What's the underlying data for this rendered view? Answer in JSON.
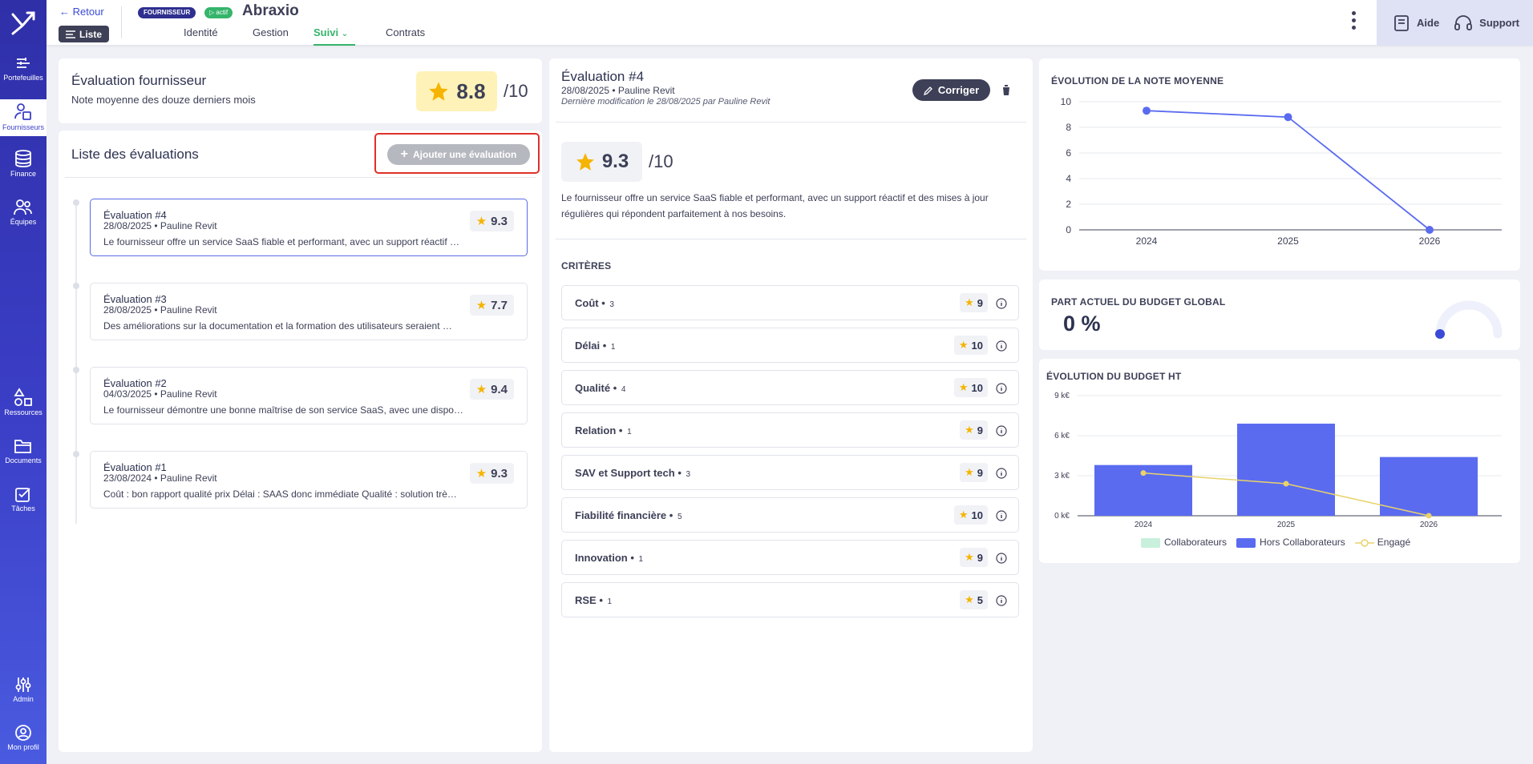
{
  "nav": {
    "items": [
      {
        "label": "Portefeuilles"
      },
      {
        "label": "Fournisseurs"
      },
      {
        "label": "Finance"
      },
      {
        "label": "Équipes"
      },
      {
        "label": "Ressources"
      },
      {
        "label": "Documents"
      },
      {
        "label": "Tâches"
      },
      {
        "label": "Admin"
      },
      {
        "label": "Mon profil"
      }
    ]
  },
  "header": {
    "back": "Retour",
    "liste": "Liste",
    "badge_type": "FOURNISSEUR",
    "badge_status": "actif",
    "vendor": "Abraxio",
    "tabs": [
      {
        "label": "Identité"
      },
      {
        "label": "Gestion"
      },
      {
        "label": "Suivi"
      },
      {
        "label": "Contrats"
      }
    ],
    "help": "Aide",
    "support": "Support"
  },
  "summary": {
    "title": "Évaluation fournisseur",
    "subtitle": "Note moyenne des douze derniers mois",
    "score": "8.8",
    "over": "/10"
  },
  "list": {
    "title": "Liste des évaluations",
    "add_button": "Ajouter une évaluation",
    "items": [
      {
        "title": "Évaluation #4",
        "meta": "28/08/2025 • Pauline Revit",
        "excerpt": "Le fournisseur offre un service SaaS fiable et performant, avec un support réactif …",
        "score": "9.3"
      },
      {
        "title": "Évaluation #3",
        "meta": "28/08/2025 • Pauline Revit",
        "excerpt": "Des améliorations sur la documentation et la formation des utilisateurs seraient …",
        "score": "7.7"
      },
      {
        "title": "Évaluation #2",
        "meta": "04/03/2025 • Pauline Revit",
        "excerpt": "Le fournisseur démontre une bonne maîtrise de son service SaaS, avec une dispo…",
        "score": "9.4"
      },
      {
        "title": "Évaluation #1",
        "meta": "23/08/2024 • Pauline Revit",
        "excerpt": "Coût : bon rapport qualité prix Délai : SAAS donc immédiate Qualité : solution trè…",
        "score": "9.3"
      }
    ]
  },
  "detail": {
    "title": "Évaluation #4",
    "meta": "28/08/2025 • Pauline Revit",
    "modified": "Dernière modification le 28/08/2025 par Pauline Revit",
    "edit": "Corriger",
    "score": "9.3",
    "over": "/10",
    "comment_line1": "Le fournisseur offre un service SaaS fiable et performant, avec un support réactif et des mises à jour",
    "comment_line2": "régulières qui répondent parfaitement à nos besoins.",
    "criteria_title": "CRITÈRES",
    "criteria": [
      {
        "name": "Coût",
        "weight": "3",
        "score": "9"
      },
      {
        "name": "Délai",
        "weight": "1",
        "score": "10"
      },
      {
        "name": "Qualité",
        "weight": "4",
        "score": "10"
      },
      {
        "name": "Relation",
        "weight": "1",
        "score": "9"
      },
      {
        "name": "SAV et Support tech",
        "weight": "3",
        "score": "9"
      },
      {
        "name": "Fiabilité financière",
        "weight": "5",
        "score": "10"
      },
      {
        "name": "Innovation",
        "weight": "1",
        "score": "9"
      },
      {
        "name": "RSE",
        "weight": "1",
        "score": "5"
      }
    ]
  },
  "budget_share": {
    "title": "PART ACTUEL DU BUDGET GLOBAL",
    "value": "0 %"
  },
  "colors": {
    "accent": "#3b4bd6",
    "bar": "#5a6bf0",
    "line": "#e9d36a",
    "star": "#f5b400"
  },
  "chart_data": [
    {
      "type": "line",
      "title": "ÉVOLUTION DE LA NOTE MOYENNE",
      "x": [
        "2024",
        "2025",
        "2026"
      ],
      "yticks": [
        "0",
        "2",
        "4",
        "6",
        "8",
        "10"
      ],
      "series": [
        {
          "values": [
            9.3,
            8.8,
            0
          ]
        }
      ],
      "ylim": [
        0,
        10
      ]
    },
    {
      "type": "bar",
      "title": "ÉVOLUTION DU BUDGET HT",
      "categories": [
        "2024",
        "2025",
        "2026"
      ],
      "yticks": [
        "0 k€",
        "3 k€",
        "6 k€",
        "9 k€"
      ],
      "ylim": [
        0,
        9
      ],
      "series": [
        {
          "name": "Collaborateurs",
          "values": [
            0,
            0,
            0
          ],
          "color": "#c8f0dc"
        },
        {
          "name": "Hors Collaborateurs",
          "values": [
            3.8,
            6.9,
            4.4
          ],
          "color": "#5a6bf0"
        },
        {
          "name": "Engagé",
          "values": [
            3.2,
            2.4,
            0
          ],
          "color": "#e9d36a",
          "kind": "line"
        }
      ]
    }
  ]
}
